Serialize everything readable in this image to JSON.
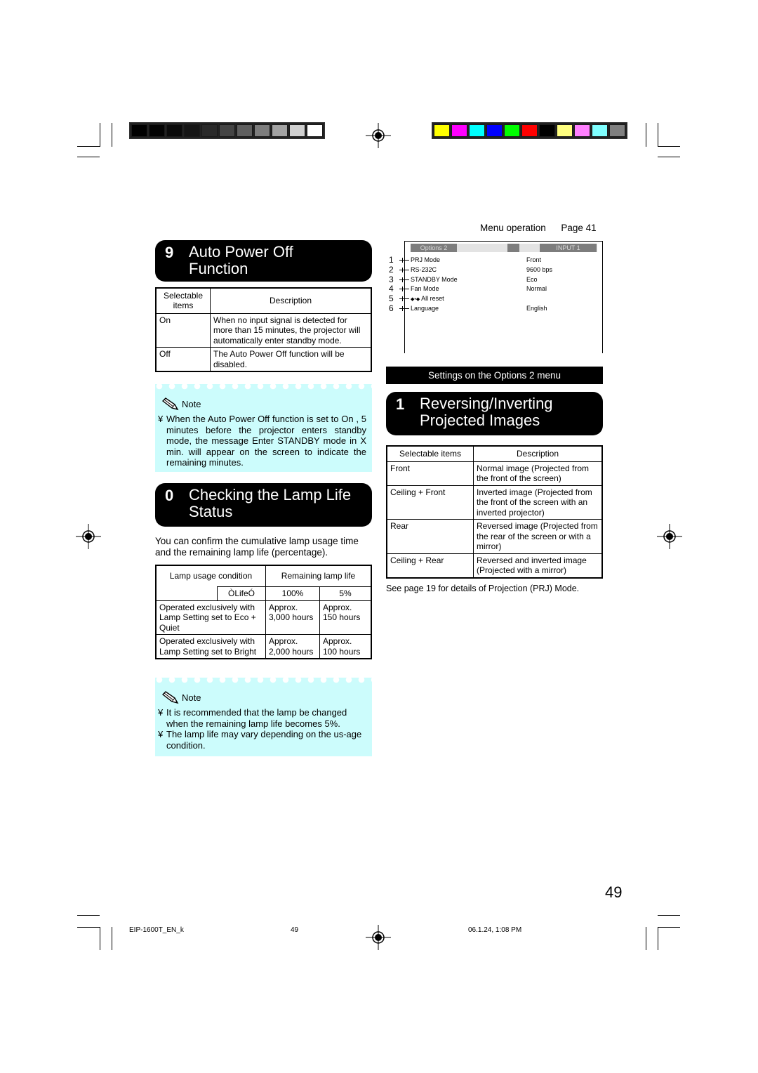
{
  "print_marks": {
    "grayscale_bar": [
      "#000000",
      "#030303",
      "#0a0a0a",
      "#151515",
      "#2a2a2a",
      "#444444",
      "#5f5f5f",
      "#7d7d7d",
      "#a2a2a2",
      "#d0d0d0",
      "#ffffff"
    ],
    "color_bar": [
      "#ffff00",
      "#ff00ff",
      "#00ffff",
      "#0000ff",
      "#00ff00",
      "#ff0000",
      "#000000",
      "#ffff80",
      "#ff80ff",
      "#80ffff",
      "#808080"
    ]
  },
  "header_ref": {
    "label": "Menu operation",
    "page": "Page 41"
  },
  "menu_screen": {
    "tab_left": "Options 2",
    "tab_right": "INPUT 1",
    "items": [
      {
        "num": "1",
        "label": "PRJ Mode",
        "value": "Front"
      },
      {
        "num": "2",
        "label": "RS-232C",
        "value": "9600 bps"
      },
      {
        "num": "3",
        "label": "STANDBY Mode",
        "value": "Eco"
      },
      {
        "num": "4",
        "label": "Fan Mode",
        "value": "Normal"
      },
      {
        "num": "5",
        "label": "All reset",
        "value": ""
      },
      {
        "num": "6",
        "label": "Language",
        "value": "English"
      }
    ],
    "caption": "Settings on the Options 2 menu"
  },
  "section_auto_power": {
    "number": "9",
    "title_line1": "Auto Power Off",
    "title_line2": "Function",
    "table": {
      "headers": [
        "Selectable items",
        "Description"
      ],
      "rows": [
        {
          "item": "On",
          "description": "When no input signal is detected for more than 15 minutes, the projector will automatically enter standby mode."
        },
        {
          "item": "Off",
          "description": "The Auto Power Off function will be disabled."
        }
      ]
    },
    "note": {
      "label": "Note",
      "bullets": [
        "When the Auto Power Off function is set to On , 5 minutes before the projector enters standby mode, the message Enter STANDBY mode in X min. will appear on the screen to indicate the remaining minutes."
      ]
    }
  },
  "section_lamp": {
    "number": "0",
    "title_line1": "Checking the Lamp Life",
    "title_line2": "Status",
    "intro": "You can confirm the cumulative lamp usage time and the remaining lamp life (percentage).",
    "table": {
      "header_condition": "Lamp usage condition",
      "header_remaining": "Remaining lamp life",
      "sub_label": "ÒLifeÓ",
      "sub_100": "100%",
      "sub_5": "5%",
      "rows": [
        {
          "condition": "Operated exclusively with Lamp Setting set to Eco + Quiet",
          "full": "Approx. 3,000 hours",
          "five": "Approx. 150 hours"
        },
        {
          "condition": "Operated exclusively with Lamp Setting set to Bright",
          "full": "Approx. 2,000 hours",
          "five": "Approx. 100 hours"
        }
      ]
    },
    "note": {
      "label": "Note",
      "bullets": [
        "It is recommended that the lamp be changed when the remaining lamp life becomes 5%.",
        "The lamp life may vary depending on the us-age condition."
      ]
    }
  },
  "section_reverse": {
    "number": "1",
    "title_line1": "Reversing/Inverting",
    "title_line2": "Projected Images",
    "table": {
      "headers": [
        "Selectable items",
        "Description"
      ],
      "rows": [
        {
          "item": "Front",
          "description": "Normal image (Projected from the front of the screen)"
        },
        {
          "item": "Ceiling + Front",
          "description": "Inverted image (Projected from the front of the screen with an inverted projector)"
        },
        {
          "item": "Rear",
          "description": "Reversed image (Projected from the rear of the screen or with a mirror)"
        },
        {
          "item": "Ceiling + Rear",
          "description": "Reversed and inverted image (Projected with a mirror)"
        }
      ]
    },
    "footnote": "See page 19 for details of Projection (PRJ) Mode."
  },
  "page_number": "49",
  "slug": {
    "file": "EIP-1600T_EN_k",
    "page": "49",
    "date": "06.1.24, 1:08 PM"
  }
}
